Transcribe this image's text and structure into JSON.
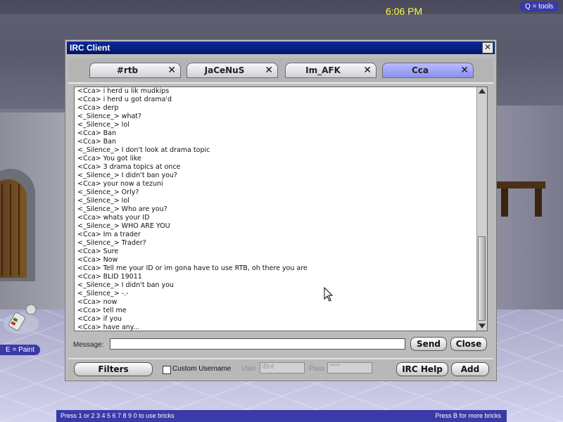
{
  "hud": {
    "clock": "6:06 PM",
    "tools_hint": "Q = tools",
    "paint_hint": "E = Paint",
    "bricks_hint_left": "Press 1 or  2 3 4 5 6 7 8 9 0 to use bricks",
    "bricks_hint_right": "Press B for more bricks"
  },
  "window": {
    "title": "IRC Client",
    "close_glyph": "✕"
  },
  "tabs": [
    {
      "label": "#rtb",
      "active": false
    },
    {
      "label": "JaCeNuS",
      "active": false
    },
    {
      "label": "Im_AFK",
      "active": false
    },
    {
      "label": "Cca",
      "active": true
    }
  ],
  "tab_close_glyph": "✕",
  "chat": {
    "lines": [
      "<Cca> i herd u lik mudkips",
      "<Cca> i herd u got drama'd",
      "<Cca> derp",
      "<_Silence_> what?",
      "<_Silence_> lol",
      "<Cca> Ban",
      "<Cca> Ban",
      "<_Silence_> I don't look at drama topic",
      "<Cca> You got like",
      "<Cca> 3 drama topics at once",
      "<_Silence_> I didn't ban you?",
      "<Cca> your now a tezuni",
      "<_Silence_> Orly?",
      "<_Silence_> lol",
      "<_Silence_> Who are you?",
      "<Cca> whats your ID",
      "<_Silence_> WHO ARE YOU",
      "<Cca> Im a trader",
      "<_Silence_> Trader?",
      "<Cca> Sure",
      "<Cca> Now",
      "<Cca> Tell me your ID or im gona have to use RTB, oh there you are",
      "<Cca> BLID 19011",
      "<_Silence_> I didn't ban you",
      "<_Silence_> -.-",
      "<Cca> now",
      "<Cca> tell me",
      "<Cca> if you",
      "<Cca> have any..."
    ]
  },
  "message": {
    "label": "Message:",
    "value": ""
  },
  "buttons": {
    "send": "Send",
    "close": "Close",
    "filters": "Filters",
    "irc_help": "IRC Help",
    "add": "Add"
  },
  "options": {
    "custom_username_label": "Custom Username",
    "custom_username_checked": false,
    "user_label": "User",
    "user_value": "iBot",
    "pass_label": "Pass",
    "pass_value": "****"
  },
  "colors": {
    "titlebar": "#04166a",
    "active_tab": "#8a90f0",
    "hud_pill": "#3a3aa8",
    "clock": "#ffff40"
  }
}
